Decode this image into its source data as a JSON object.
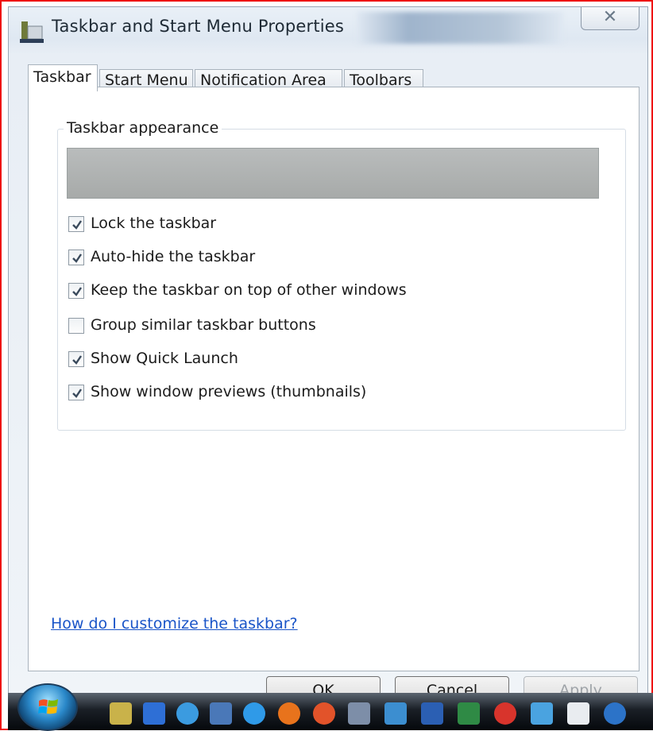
{
  "window": {
    "title": "Taskbar and Start Menu Properties",
    "close_icon": "✕"
  },
  "tabs": [
    {
      "label": "Taskbar",
      "active": true
    },
    {
      "label": "Start Menu",
      "active": false
    },
    {
      "label": "Notification Area",
      "active": false
    },
    {
      "label": "Toolbars",
      "active": false
    }
  ],
  "taskbar_appearance": {
    "legend": "Taskbar appearance",
    "options": [
      {
        "label": "Lock the taskbar",
        "checked": true
      },
      {
        "label": "Auto-hide the taskbar",
        "checked": true
      },
      {
        "label": "Keep the taskbar on top of other windows",
        "checked": true
      },
      {
        "label": "Group similar taskbar buttons",
        "checked": false
      },
      {
        "label": "Show Quick Launch",
        "checked": true
      },
      {
        "label": "Show window previews (thumbnails)",
        "checked": true
      }
    ]
  },
  "help_link": "How do I customize the taskbar?",
  "buttons": {
    "ok": "OK",
    "cancel": "Cancel",
    "apply": "Apply"
  },
  "taskbar_icons": [
    "explorer-folder-icon",
    "computer-icon",
    "globe-icon",
    "window-switcher-icon",
    "internet-explorer-icon",
    "firefox-icon",
    "media-icon",
    "printer-icon",
    "calculator-icon",
    "word-icon",
    "excel-icon",
    "opera-icon",
    "network-icon",
    "document-icon",
    "sync-icon"
  ],
  "colors": {
    "link": "#1a55c8",
    "taskbar": "#1a1f26",
    "border_highlight": "#e11111"
  }
}
